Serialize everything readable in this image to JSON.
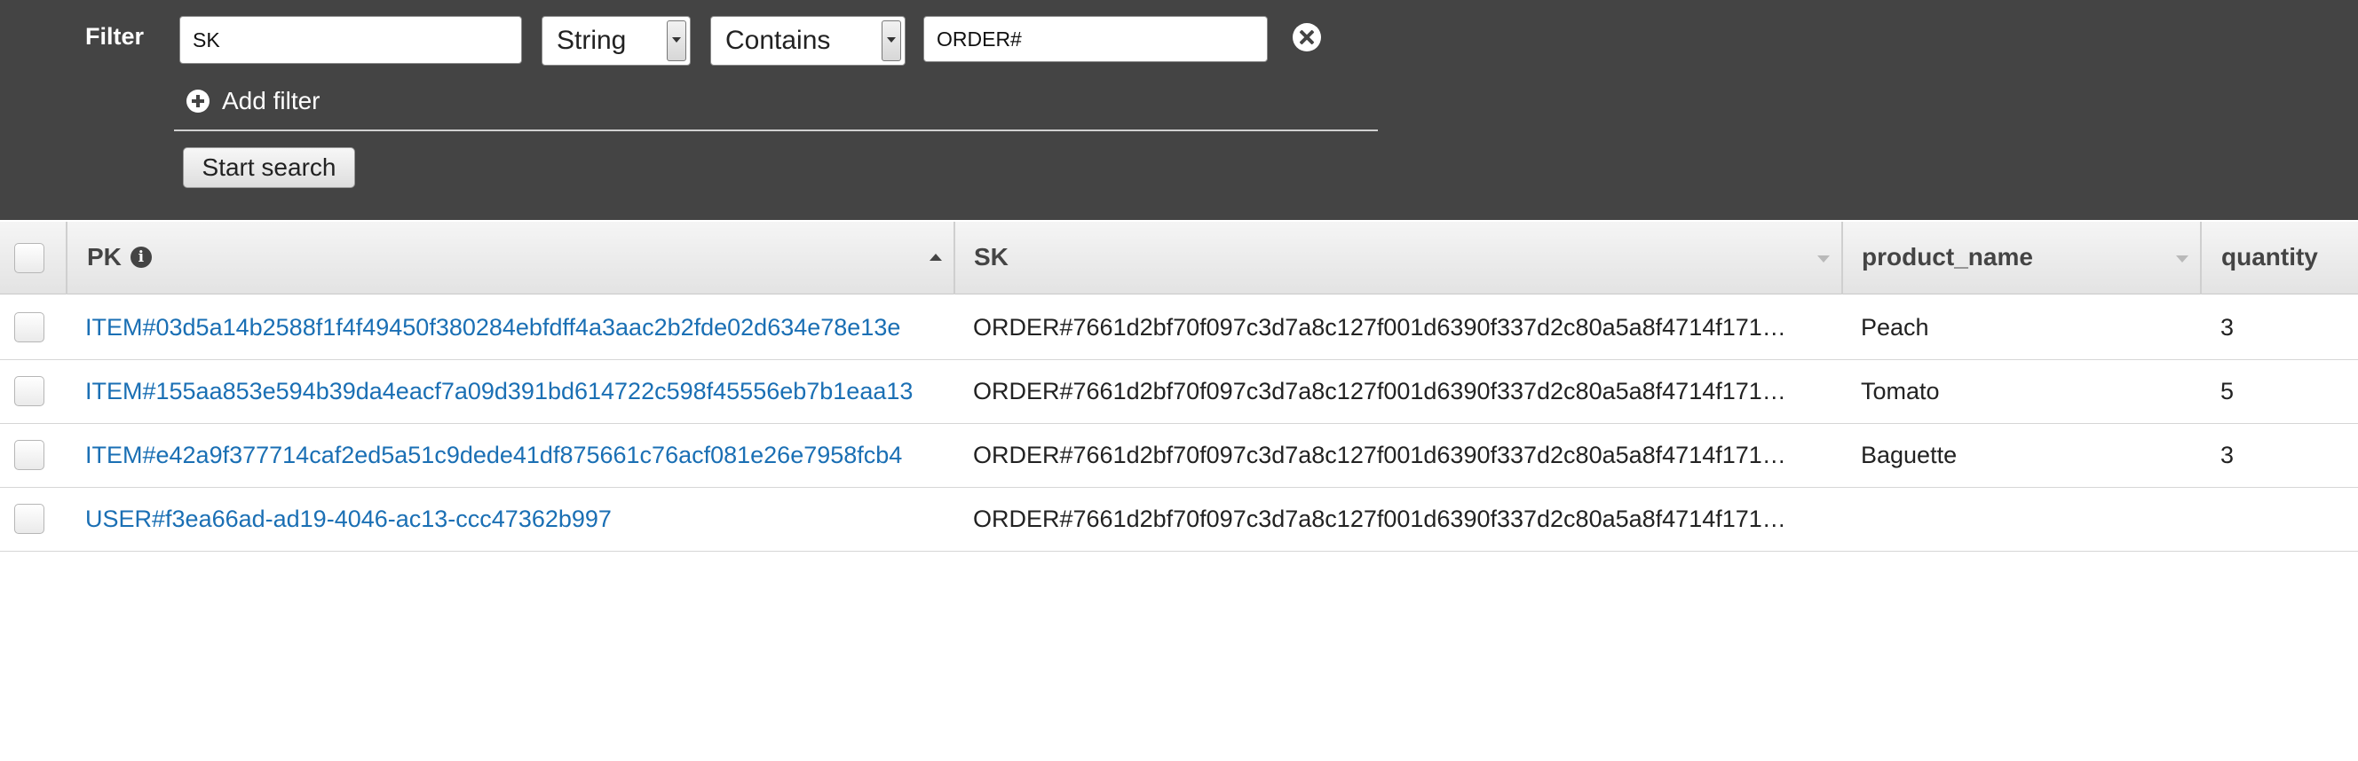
{
  "filter": {
    "label": "Filter",
    "attribute_value": "SK",
    "type_selected": "String",
    "condition_selected": "Contains",
    "value": "ORDER#",
    "add_filter_label": "Add filter",
    "start_search_label": "Start search"
  },
  "grid": {
    "columns": {
      "pk": "PK",
      "sk": "SK",
      "product_name": "product_name",
      "quantity": "quantity"
    },
    "rows": [
      {
        "pk": "ITEM#03d5a14b2588f1f4f49450f380284ebfdff4a3aac2b2fde02d634e78e13e",
        "sk": "ORDER#7661d2bf70f097c3d7a8c127f001d6390f337d2c80a5a8f4714f171…",
        "product_name": "Peach",
        "quantity": "3"
      },
      {
        "pk": "ITEM#155aa853e594b39da4eacf7a09d391bd614722c598f45556eb7b1eaa13",
        "sk": "ORDER#7661d2bf70f097c3d7a8c127f001d6390f337d2c80a5a8f4714f171…",
        "product_name": "Tomato",
        "quantity": "5"
      },
      {
        "pk": "ITEM#e42a9f377714caf2ed5a51c9dede41df875661c76acf081e26e7958fcb4",
        "sk": "ORDER#7661d2bf70f097c3d7a8c127f001d6390f337d2c80a5a8f4714f171…",
        "product_name": "Baguette",
        "quantity": "3"
      },
      {
        "pk": "USER#f3ea66ad-ad19-4046-ac13-ccc47362b997",
        "sk": "ORDER#7661d2bf70f097c3d7a8c127f001d6390f337d2c80a5a8f4714f171…",
        "product_name": "",
        "quantity": ""
      }
    ]
  },
  "icons": {
    "info": "info-icon",
    "remove": "close-circle-icon",
    "add": "plus-circle-icon"
  }
}
